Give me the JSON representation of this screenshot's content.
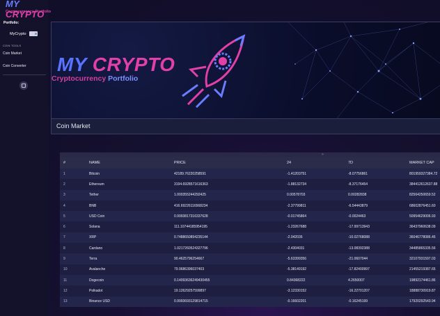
{
  "sidebar": {
    "logo_line1a": "MY",
    "logo_line1b": "CRYPTO",
    "logo_line2": "Cryptocurrency Portfolio",
    "portfolio_label": "Portfolio:",
    "portfolio_name": "MyCrypto",
    "tools_label": "COIN TOOLS",
    "items": [
      {
        "label": "Coin Market"
      },
      {
        "label": "Coin Converter"
      }
    ]
  },
  "banner": {
    "title_a": "MY",
    "title_b": "CRYPTO",
    "subtitle_a": "Cryptocurrency",
    "subtitle_b": "Portfolio",
    "caption": "Coin Market"
  },
  "table": {
    "scroll_indicator": "»",
    "headers": [
      "#",
      "NAME",
      "PRICE",
      "24",
      "7D",
      "MARKET CAP"
    ],
    "rows": [
      [
        "1",
        "Bitcoin",
        "42189.76220258591",
        "-1.41203751",
        "-8.07756861",
        "801959327384.72"
      ],
      [
        "2",
        "Ethereum",
        "3194.6928571616363",
        "-1.88132734",
        "-8.37176454",
        "384412612637.88"
      ],
      [
        "3",
        "Tether",
        "1.000355244292425",
        "0.00578703",
        "0.00282838",
        "82564250659.52"
      ],
      [
        "4",
        "BNB",
        "416.69226116568234",
        "-2.37799811",
        "-6.54443879",
        "68602876451.60"
      ],
      [
        "5",
        "USD Coin",
        "0.9993817316337628",
        "-0.01745864",
        "-0.0024463",
        "50954629006.93"
      ],
      [
        "6",
        "Solana",
        "111.10744185954195",
        "-1.23267688",
        "-17.99713943",
        "36437960638.09"
      ],
      [
        "7",
        "XRP",
        "0.7488650894235144",
        "-2.042035",
        "-10.02768088",
        "36046778086.45"
      ],
      [
        "8",
        "Cardano",
        "1.0217260524327796",
        "-2.4304031",
        "-13.08392388",
        "34485865335.56"
      ],
      [
        "9",
        "Terra",
        "90.4625796254667",
        "-5.63399356",
        "-21.0607044",
        "32107931597.03"
      ],
      [
        "10",
        "Avalanche",
        "79.9686396037403",
        "-5.38149192",
        "-17.82400997",
        "21455219387.65"
      ],
      [
        "11",
        "Dogecoin",
        "0.14093636249430455",
        "0.84368222",
        "4.2650007",
        "19892174461.86"
      ],
      [
        "12",
        "Polkadot",
        "19.126292575998​97",
        "-3.12330152",
        "-16.22701207",
        "18888730919.87"
      ],
      [
        "13",
        "Binance USD",
        "0.9993693129814715",
        "-0.16602201",
        "-0.16245199",
        "17920292543.94"
      ]
    ]
  },
  "colors": {
    "brand_blue": "#5a73ff",
    "brand_pink": "#e040a8",
    "sidebar_bg": "#14122b",
    "row_odd": "#24254a",
    "row_even": "#1e1f40"
  }
}
